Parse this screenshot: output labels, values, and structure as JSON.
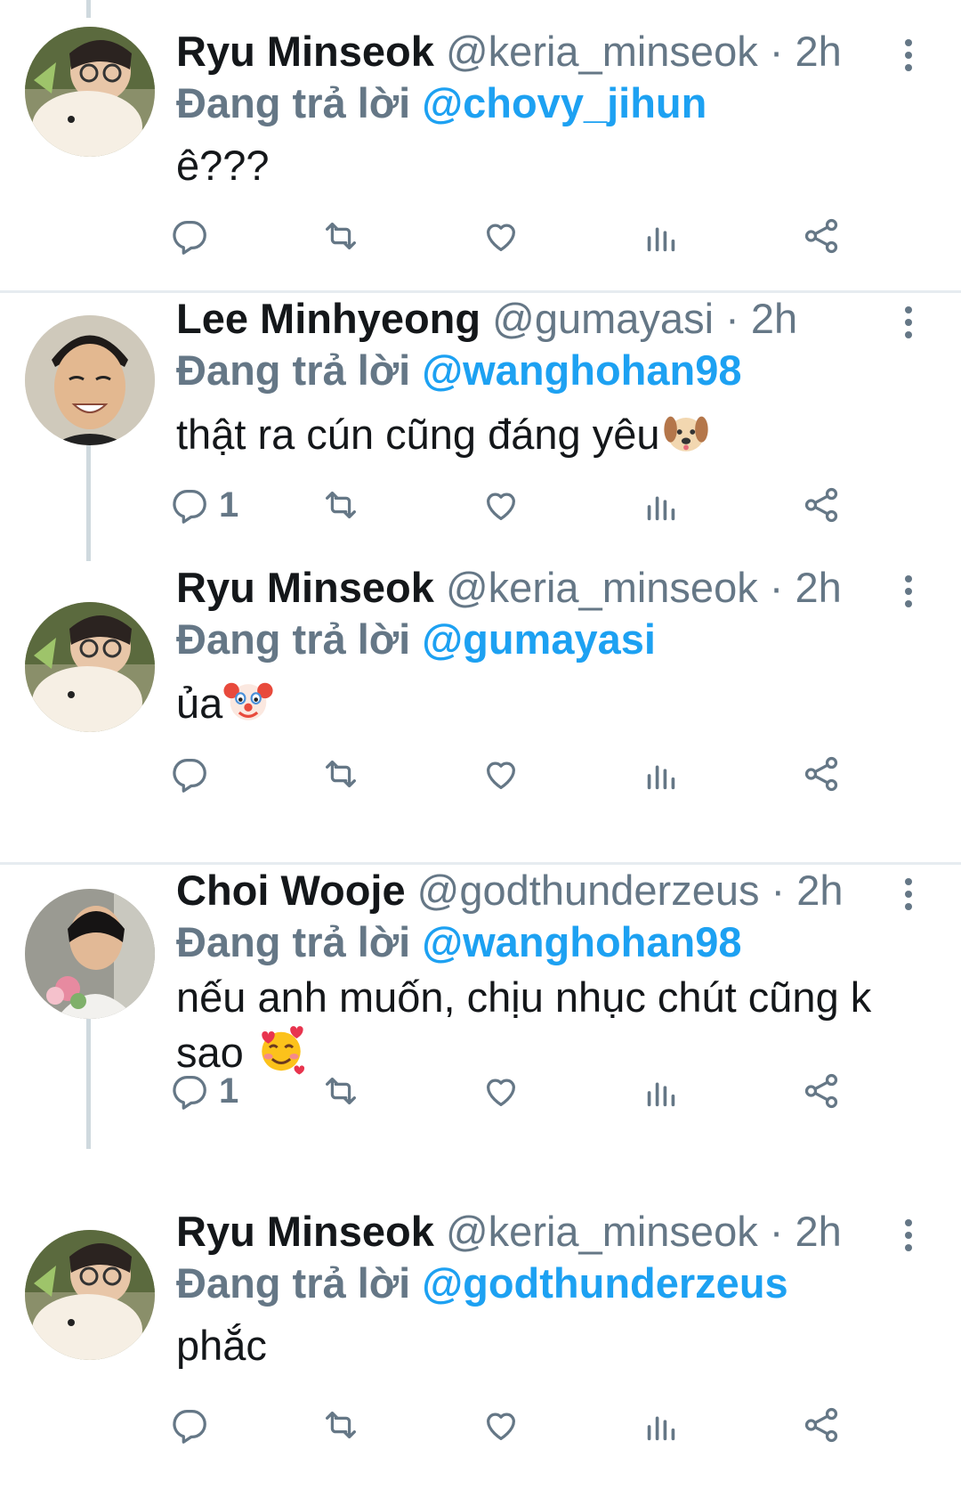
{
  "tweets": [
    {
      "name": "Ryu Minseok",
      "handle": "@keria_minseok",
      "time": "2h",
      "replying_label": "Đang trả lời",
      "mention": "@chovy_jihun",
      "text": "ê???",
      "reply_count": ""
    },
    {
      "name": "Lee Minhyeong",
      "handle": "@gumayasi",
      "time": "2h",
      "replying_label": "Đang trả lời",
      "mention": "@wanghohan98",
      "text": "thật ra cún cũng đáng yêu",
      "emoji": "dog-face",
      "reply_count": "1"
    },
    {
      "name": "Ryu Minseok",
      "handle": "@keria_minseok",
      "time": "2h",
      "replying_label": "Đang trả lời",
      "mention": "@gumayasi",
      "text": "ủa",
      "emoji": "clown-face",
      "reply_count": ""
    },
    {
      "name": "Choi Wooje",
      "handle": "@godthunderzeus",
      "time": "2h",
      "replying_label": "Đang trả lời",
      "mention": "@wanghohan98",
      "text": "nếu anh muốn, chịu nhục chút cũng k sao ",
      "emoji": "smiling-face-with-hearts",
      "reply_count": "1"
    },
    {
      "name": "Ryu Minseok",
      "handle": "@keria_minseok",
      "time": "2h",
      "replying_label": "Đang trả lời",
      "mention": "@godthunderzeus",
      "text": "phắc",
      "reply_count": ""
    }
  ],
  "separator": " · ",
  "colors": {
    "link": "#1da1f2",
    "secondary": "#657786",
    "text": "#14171a",
    "divider": "#e6ecf0",
    "thread_line": "#cfd9de"
  },
  "icons": [
    "reply-icon",
    "retweet-icon",
    "like-icon",
    "analytics-icon",
    "share-icon",
    "more-options-icon"
  ]
}
